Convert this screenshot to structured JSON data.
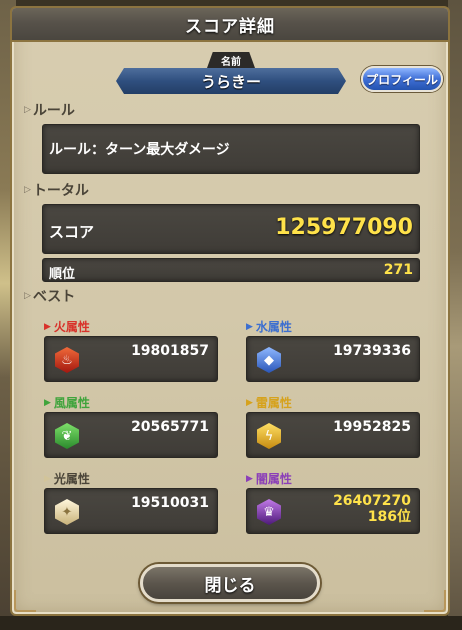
{
  "header": {
    "title": "スコア詳細"
  },
  "player": {
    "name_tag": "名前",
    "name": "うらきー",
    "profile_label": "プロフィール"
  },
  "rule": {
    "section": "ルール",
    "text": "ルール：ターン最大ダメージ"
  },
  "total": {
    "section": "トータル",
    "score_label": "スコア",
    "score": "125977090",
    "rank_label": "順位",
    "rank": "271"
  },
  "best": {
    "section": "ベスト",
    "attributes": [
      {
        "label": "火属性",
        "value": "19801857",
        "color": "#d8322a",
        "icon": "fire-icon"
      },
      {
        "label": "水属性",
        "value": "19739336",
        "color": "#3c6fd0",
        "icon": "water-icon"
      },
      {
        "label": "風属性",
        "value": "20565771",
        "color": "#3fa43c",
        "icon": "wind-icon"
      },
      {
        "label": "雷属性",
        "value": "19952825",
        "color": "#d6a21c",
        "icon": "thunder-icon"
      },
      {
        "label": "光属性",
        "value": "19510031",
        "color": "#d2c49a",
        "icon": "light-icon"
      },
      {
        "label": "闇属性",
        "value": "26407270",
        "rank": "186位",
        "color": "#8b3fb8",
        "icon": "dark-icon"
      }
    ]
  },
  "close_label": "閉じる"
}
